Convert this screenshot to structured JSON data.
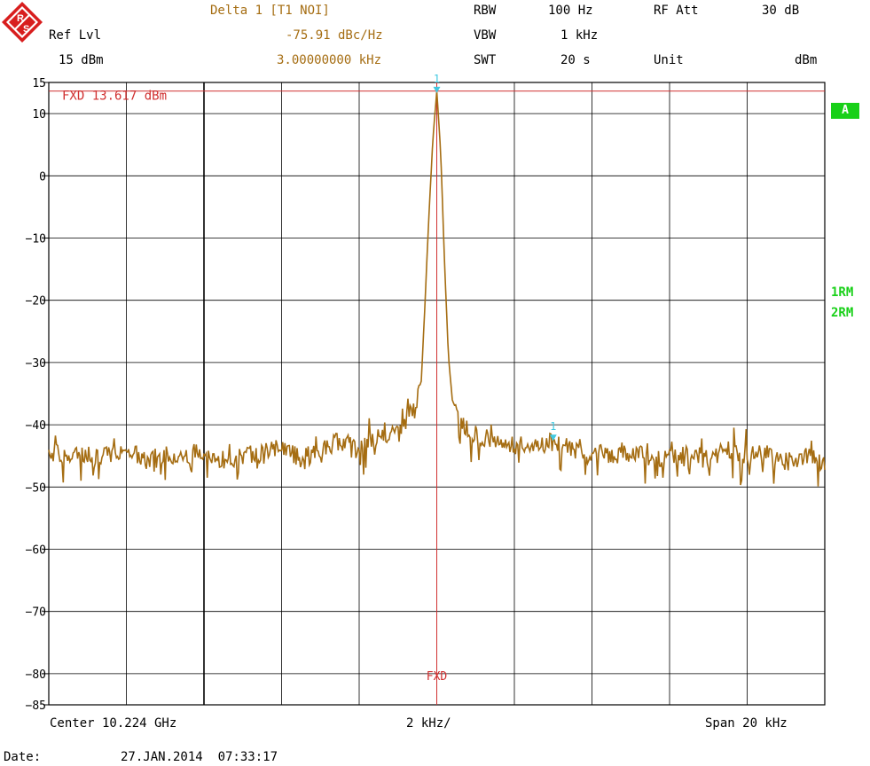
{
  "header": {
    "delta_label": "Delta 1 [T1 NOI]",
    "delta_value": "-75.91 dBc/Hz",
    "delta_freq": "3.00000000 kHz",
    "ref_lvl_label": "Ref Lvl",
    "ref_lvl_value": "15 dBm",
    "rbw_label": "RBW",
    "rbw_value": "100 Hz",
    "vbw_label": "VBW",
    "vbw_value": "1 kHz",
    "swt_label": "SWT",
    "swt_value": "20 s",
    "rf_att_label": "RF Att",
    "rf_att_value": "30 dB",
    "unit_label": "Unit",
    "unit_value": "dBm"
  },
  "side": {
    "trace_a_badge": "A",
    "trace1_label": "1RM",
    "trace2_label": "2RM"
  },
  "footer": {
    "center": "Center 10.224 GHz",
    "div": "2 kHz/",
    "span": "Span 20 kHz",
    "date_label": "Date:",
    "date_value": "27.JAN.2014  07:33:17"
  },
  "colors": {
    "trace": "#a56d12",
    "grid": "#000000",
    "fxd_line": "#d03030",
    "marker": "#40c8e0",
    "status_green": "#18d018"
  },
  "chart_data": {
    "type": "line",
    "ylim": [
      -85,
      15
    ],
    "xlim": [
      -10,
      10
    ],
    "y_ticks": [
      15,
      10,
      0,
      -10,
      -20,
      -30,
      -40,
      -50,
      -60,
      -70,
      -80,
      -85
    ],
    "grid": true,
    "fxd_label": "FXD 13.617 dBm",
    "fxd_level": 13.617,
    "fxd_x_label": "FXD",
    "fxd_x": 0,
    "markers": [
      {
        "label": "1",
        "x": 0,
        "y": 13.6
      },
      {
        "label": "1",
        "x": 3.0,
        "y": -42.3
      }
    ],
    "series": [
      {
        "x": [
          -10,
          -9.5,
          -9,
          -8.5,
          -8,
          -7.5,
          -7,
          -6.5,
          -6,
          -5.5,
          -5,
          -4.5,
          -4,
          -3.5,
          -3,
          -2.5,
          -2,
          -1.5,
          -1,
          -0.8,
          -0.6,
          -0.4,
          -0.3,
          -0.2,
          -0.1,
          0,
          0.1,
          0.2,
          0.3,
          0.4,
          0.6,
          0.8,
          1,
          1.5,
          2,
          2.5,
          3,
          3.5,
          4,
          4.5,
          5,
          5.5,
          6,
          6.5,
          7,
          7.5,
          8,
          8.5,
          9,
          9.5,
          10
        ],
        "y": [
          -44,
          -45.5,
          -44.5,
          -45,
          -43.5,
          -46,
          -44.5,
          -45,
          -44,
          -46.5,
          -45,
          -44.5,
          -43.5,
          -45.5,
          -44,
          -42.5,
          -44,
          -42,
          -41,
          -39.5,
          -37,
          -33,
          -20,
          -6,
          6,
          13.6,
          4,
          -14,
          -29,
          -36,
          -39.5,
          -41,
          -41.5,
          -42.5,
          -43.5,
          -43,
          -42.3,
          -44,
          -44.5,
          -45,
          -44,
          -45.5,
          -45,
          -44,
          -45.5,
          -44,
          -45,
          -44.5,
          -46,
          -45,
          -46
        ]
      }
    ]
  }
}
